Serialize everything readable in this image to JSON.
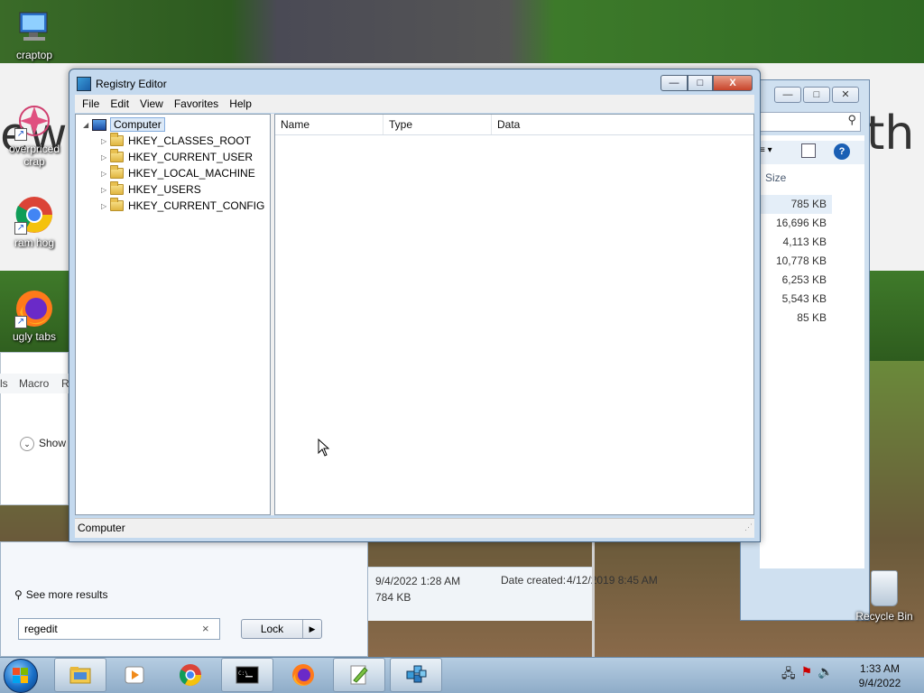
{
  "desktop": {
    "icons": [
      {
        "label": "craptop",
        "icon": "computer-icon"
      },
      {
        "label": "overpriced crap",
        "icon": "itunes-icon"
      },
      {
        "label": "ram hog",
        "icon": "chrome-icon"
      },
      {
        "label": "ugly tabs",
        "icon": "firefox-icon"
      }
    ],
    "recycle_bin_label": "Recycle Bin",
    "banner_left": "ew",
    "banner_right": "th"
  },
  "registry_editor": {
    "title": "Registry Editor",
    "caption": {
      "minimize": "—",
      "maximize": "□",
      "close": "X"
    },
    "menu": [
      "File",
      "Edit",
      "View",
      "Favorites",
      "Help"
    ],
    "tree": {
      "root": "Computer",
      "keys": [
        "HKEY_CLASSES_ROOT",
        "HKEY_CURRENT_USER",
        "HKEY_LOCAL_MACHINE",
        "HKEY_USERS",
        "HKEY_CURRENT_CONFIG"
      ]
    },
    "columns": [
      "Name",
      "Type",
      "Data"
    ],
    "status": "Computer"
  },
  "explorer_bg": {
    "size_header": "Size",
    "sizes": [
      "785 KB",
      "16,696 KB",
      "4,113 KB",
      "10,778 KB",
      "6,253 KB",
      "5,543 KB",
      "85 KB"
    ],
    "details": {
      "modified": "9/4/2022 1:28 AM",
      "size": "784 KB",
      "created_label": "Date created:",
      "created": "4/12/2019 8:45 AM"
    }
  },
  "left_app": {
    "menu_items": [
      "ls",
      "Macro",
      "R"
    ],
    "show_label": "Show"
  },
  "start_menu": {
    "see_more": "See more results",
    "search_value": "regedit",
    "clear": "×",
    "lock_label": "Lock"
  },
  "taskbar": {
    "apps": [
      "explorer",
      "media-player",
      "chrome",
      "cmd",
      "firefox",
      "notepad-plus",
      "regedit"
    ],
    "time": "1:33 AM",
    "date": "9/4/2022"
  }
}
